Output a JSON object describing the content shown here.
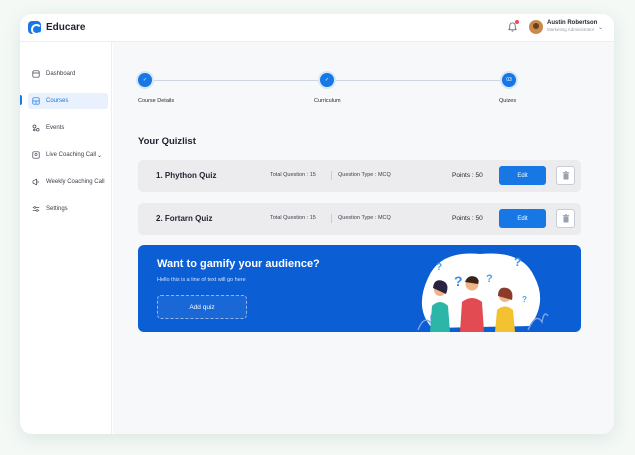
{
  "app": {
    "name": "Educare"
  },
  "user": {
    "name": "Austin Robertson",
    "role": "Marketing Administrator"
  },
  "colors": {
    "accent": "#1677e5",
    "banner": "#0c5ed4",
    "notification": "#f04a55"
  },
  "sidebar": {
    "items": [
      {
        "label": "Dashboard",
        "icon": "dashboard-icon"
      },
      {
        "label": "Courses",
        "icon": "courses-icon",
        "active": true
      },
      {
        "label": "Events",
        "icon": "events-icon"
      },
      {
        "label": "Live Coaching Call",
        "icon": "live-call-icon",
        "has_submenu": true
      },
      {
        "label": "Weekly Coaching Call",
        "icon": "megaphone-icon"
      },
      {
        "label": "Settings",
        "icon": "sliders-icon"
      }
    ]
  },
  "stepper": {
    "steps": [
      {
        "label": "Course Details",
        "state": "done",
        "marker": "✓"
      },
      {
        "label": "Curriculum",
        "state": "done",
        "marker": "✓"
      },
      {
        "label": "Quizes",
        "state": "current",
        "marker": "03"
      }
    ]
  },
  "quizlist": {
    "title": "Your Quizlist",
    "quizzes": [
      {
        "name": "1.  Phython Quiz",
        "total_questions": "Total Question : 15",
        "question_type": "Question Type : MCQ",
        "points": "Points :  50",
        "edit_label": "Edit"
      },
      {
        "name": "2.  Fortarn Quiz",
        "total_questions": "Total Question : 15",
        "question_type": "Question Type : MCQ",
        "points": "Points :  50",
        "edit_label": "Edit"
      }
    ]
  },
  "banner": {
    "title": "Want to gamify your audience?",
    "subtitle": "Hello this is a line of text will go here",
    "button_label": "Add quiz"
  }
}
